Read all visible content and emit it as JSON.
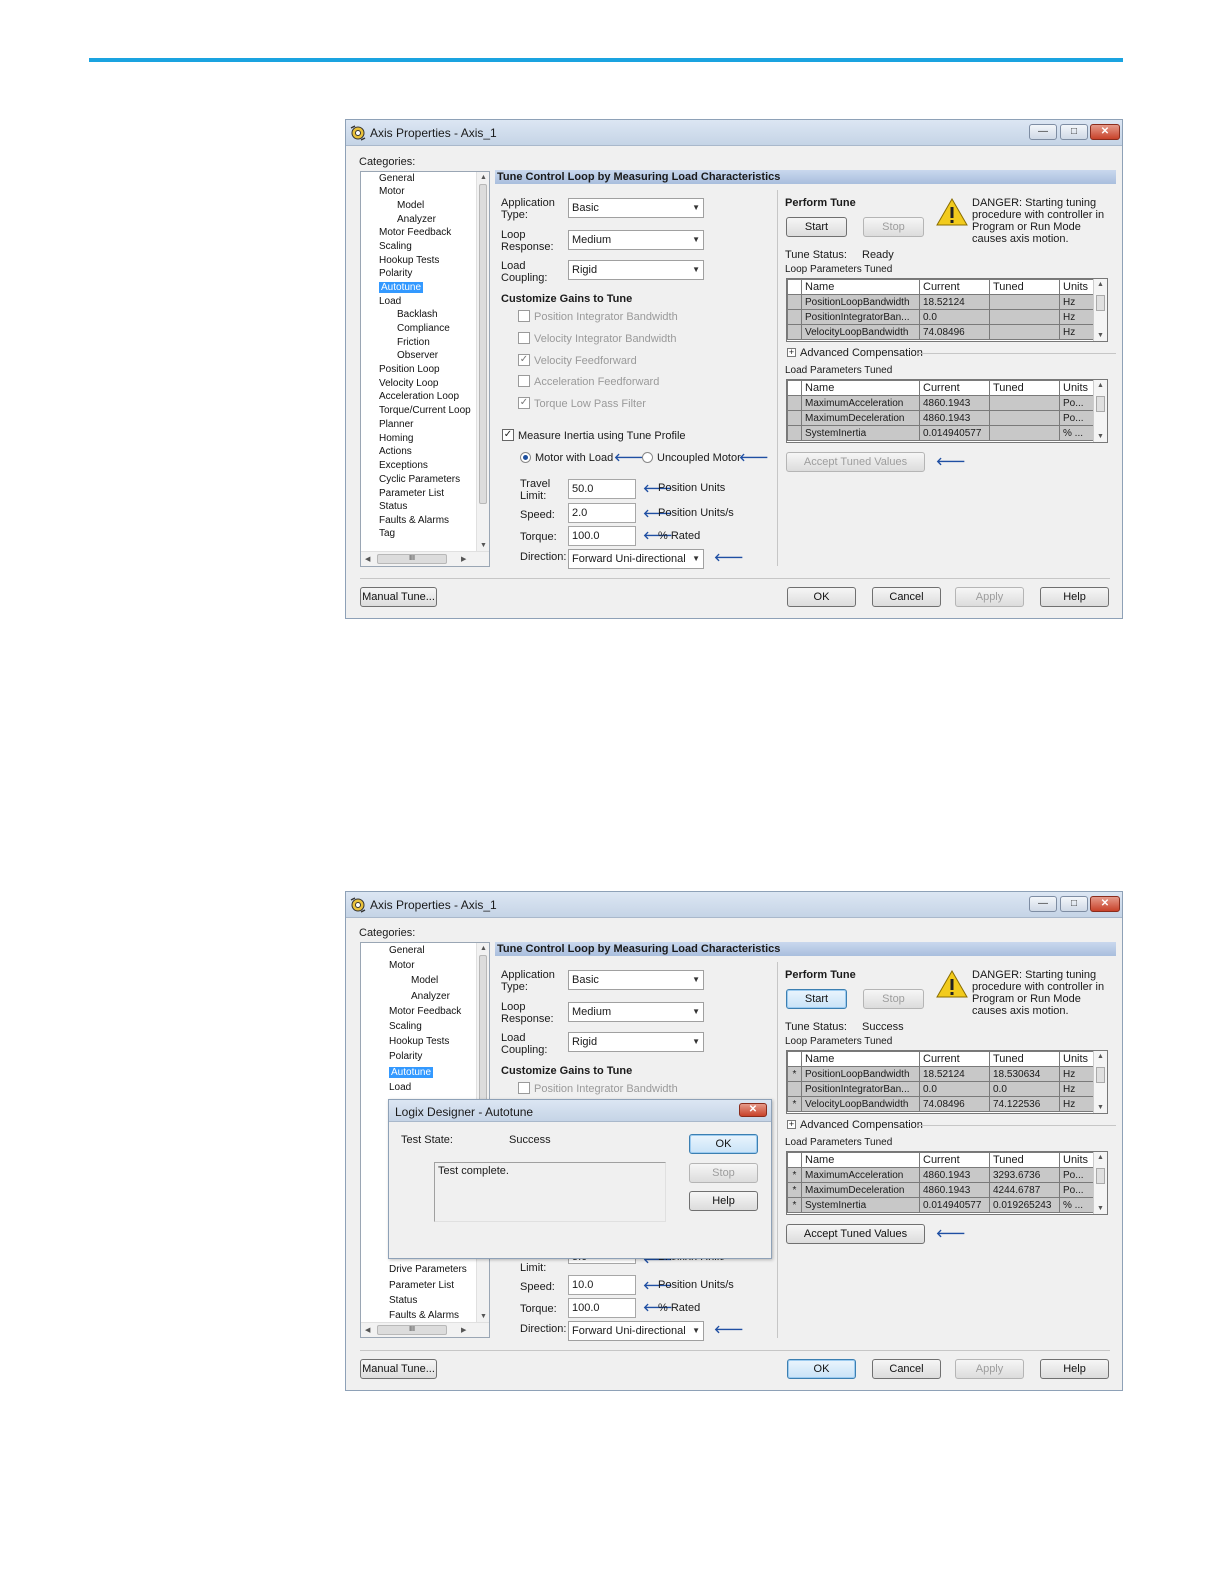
{
  "windows": [
    {
      "title": "Axis Properties - Axis_1",
      "categories_label": "Categories:",
      "tree_items": [
        {
          "label": "General",
          "selected": false
        },
        {
          "label": "Motor",
          "selected": false
        },
        {
          "label": "Model",
          "selected": false
        },
        {
          "label": "Analyzer",
          "selected": false
        },
        {
          "label": "Motor Feedback",
          "selected": false
        },
        {
          "label": "Scaling",
          "selected": false
        },
        {
          "label": "Hookup Tests",
          "selected": false
        },
        {
          "label": "Polarity",
          "selected": false
        },
        {
          "label": "Autotune",
          "selected": true
        },
        {
          "label": "Load",
          "selected": false
        },
        {
          "label": "Backlash",
          "selected": false
        },
        {
          "label": "Compliance",
          "selected": false
        },
        {
          "label": "Friction",
          "selected": false
        },
        {
          "label": "Observer",
          "selected": false
        },
        {
          "label": "Position Loop",
          "selected": false
        },
        {
          "label": "Velocity Loop",
          "selected": false
        },
        {
          "label": "Acceleration Loop",
          "selected": false
        },
        {
          "label": "Torque/Current Loop",
          "selected": false
        },
        {
          "label": "Planner",
          "selected": false
        },
        {
          "label": "Homing",
          "selected": false
        },
        {
          "label": "Actions",
          "selected": false
        },
        {
          "label": "Exceptions",
          "selected": false
        },
        {
          "label": "Cyclic Parameters",
          "selected": false
        },
        {
          "label": "Parameter List",
          "selected": false
        },
        {
          "label": "Status",
          "selected": false
        },
        {
          "label": "Faults & Alarms",
          "selected": false
        },
        {
          "label": "Tag",
          "selected": false
        }
      ],
      "hscroll_label": "III",
      "header": "Tune Control Loop by Measuring Load Characteristics",
      "app_type_label": "Application Type:",
      "app_type_value": "Basic",
      "loop_resp_label": "Loop Response:",
      "loop_resp_value": "Medium",
      "load_coupling_label": "Load Coupling:",
      "load_coupling_value": "Rigid",
      "gains_title": "Customize Gains to Tune",
      "gains": [
        {
          "label": "Position Integrator Bandwidth",
          "checked": false
        },
        {
          "label": "Velocity Integrator Bandwidth",
          "checked": false
        },
        {
          "label": "Velocity Feedforward",
          "checked": true
        },
        {
          "label": "Acceleration Feedforward",
          "checked": false
        },
        {
          "label": "Torque Low Pass Filter",
          "checked": true
        }
      ],
      "measure_label": "Measure Inertia using Tune Profile",
      "measure_checked": true,
      "motor_with_load": "Motor with Load",
      "uncoupled_motor": "Uncoupled Motor",
      "travel_label": "Travel Limit:",
      "travel_value": "50.0",
      "travel_units": "Position Units",
      "speed_label": "Speed:",
      "speed_value": "2.0",
      "speed_units": "Position Units/s",
      "torque_label": "Torque:",
      "torque_value": "100.0",
      "torque_units": "% Rated",
      "direction_label": "Direction:",
      "direction_value": "Forward Uni-directional",
      "perform_tune": "Perform Tune",
      "start": "Start",
      "stop": "Stop",
      "danger": "DANGER: Starting tuning procedure with controller in Program or Run Mode causes axis motion.",
      "tune_status_label": "Tune Status:",
      "tune_status_value": "Ready",
      "loop_params_label": "Loop Parameters Tuned",
      "col_name": "Name",
      "col_current": "Current",
      "col_tuned": "Tuned",
      "col_units": "Units",
      "loop_rows": [
        {
          "mark": "",
          "name": "PositionLoopBandwidth",
          "current": "18.52124",
          "tuned": "",
          "units": "Hz"
        },
        {
          "mark": "",
          "name": "PositionIntegratorBan...",
          "current": "0.0",
          "tuned": "",
          "units": "Hz"
        },
        {
          "mark": "",
          "name": "VelocityLoopBandwidth",
          "current": "74.08496",
          "tuned": "",
          "units": "Hz"
        }
      ],
      "advanced_comp": "Advanced Compensation",
      "load_params_label": "Load Parameters Tuned",
      "load_rows": [
        {
          "mark": "",
          "name": "MaximumAcceleration",
          "current": "4860.1943",
          "tuned": "",
          "units": "Po..."
        },
        {
          "mark": "",
          "name": "MaximumDeceleration",
          "current": "4860.1943",
          "tuned": "",
          "units": "Po..."
        },
        {
          "mark": "",
          "name": "SystemInertia",
          "current": "0.014940577",
          "tuned": "",
          "units": "% ..."
        }
      ],
      "accept_tuned": "Accept Tuned Values",
      "manual_tune": "Manual Tune...",
      "ok": "OK",
      "cancel": "Cancel",
      "apply": "Apply",
      "help": "Help"
    },
    {
      "title": "Axis Properties - Axis_1",
      "categories_label": "Categories:",
      "tree_items": [
        {
          "label": "General",
          "selected": false
        },
        {
          "label": "Motor",
          "selected": false
        },
        {
          "label": "Model",
          "selected": false
        },
        {
          "label": "Analyzer",
          "selected": false
        },
        {
          "label": "Motor Feedback",
          "selected": false
        },
        {
          "label": "Scaling",
          "selected": false
        },
        {
          "label": "Hookup Tests",
          "selected": false
        },
        {
          "label": "Polarity",
          "selected": false
        },
        {
          "label": "Autotune",
          "selected": true
        },
        {
          "label": "Load",
          "selected": false
        },
        {
          "label": "Drive Parameters",
          "selected": false
        },
        {
          "label": "Parameter List",
          "selected": false
        },
        {
          "label": "Status",
          "selected": false
        },
        {
          "label": "Faults & Alarms",
          "selected": false
        }
      ],
      "hscroll_label": "III",
      "header": "Tune Control Loop by Measuring Load Characteristics",
      "app_type_label": "Application Type:",
      "app_type_value": "Basic",
      "loop_resp_label": "Loop Response:",
      "loop_resp_value": "Medium",
      "load_coupling_label": "Load Coupling:",
      "load_coupling_value": "Rigid",
      "gains_title": "Customize Gains to Tune",
      "gain0": "Position Integrator Bandwidth",
      "travel_limit_partial": "Limit:",
      "travel_value": "5.0",
      "travel_units": "Position Units",
      "speed_label": "Speed:",
      "speed_value": "10.0",
      "speed_units": "Position Units/s",
      "torque_label": "Torque:",
      "torque_value": "100.0",
      "torque_units": "% Rated",
      "direction_label": "Direction:",
      "direction_value": "Forward Uni-directional",
      "perform_tune": "Perform Tune",
      "start": "Start",
      "stop": "Stop",
      "danger": "DANGER: Starting tuning procedure with controller in Program or Run Mode causes axis motion.",
      "tune_status_label": "Tune Status:",
      "tune_status_value": "Success",
      "loop_params_label": "Loop Parameters Tuned",
      "col_name": "Name",
      "col_current": "Current",
      "col_tuned": "Tuned",
      "col_units": "Units",
      "loop_rows": [
        {
          "mark": "*",
          "name": "PositionLoopBandwidth",
          "current": "18.52124",
          "tuned": "18.530634",
          "units": "Hz"
        },
        {
          "mark": "",
          "name": "PositionIntegratorBan...",
          "current": "0.0",
          "tuned": "0.0",
          "units": "Hz"
        },
        {
          "mark": "*",
          "name": "VelocityLoopBandwidth",
          "current": "74.08496",
          "tuned": "74.122536",
          "units": "Hz"
        }
      ],
      "advanced_comp": "Advanced Compensation",
      "load_params_label": "Load Parameters Tuned",
      "load_rows": [
        {
          "mark": "*",
          "name": "MaximumAcceleration",
          "current": "4860.1943",
          "tuned": "3293.6736",
          "units": "Po..."
        },
        {
          "mark": "*",
          "name": "MaximumDeceleration",
          "current": "4860.1943",
          "tuned": "4244.6787",
          "units": "Po..."
        },
        {
          "mark": "*",
          "name": "SystemInertia",
          "current": "0.014940577",
          "tuned": "0.019265243",
          "units": "% ..."
        }
      ],
      "accept_tuned": "Accept Tuned Values",
      "manual_tune": "Manual Tune...",
      "ok": "OK",
      "cancel": "Cancel",
      "apply": "Apply",
      "help": "Help",
      "dialog": {
        "title": "Logix Designer - Autotune",
        "test_state_label": "Test State:",
        "test_state_value": "Success",
        "message": "Test complete.",
        "ok": "OK",
        "stop": "Stop",
        "help": "Help"
      }
    }
  ]
}
